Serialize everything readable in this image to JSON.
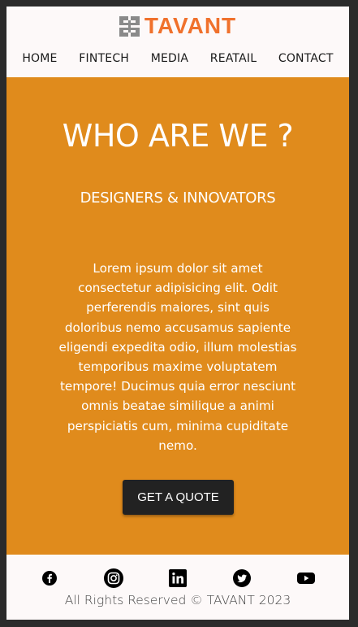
{
  "brand": {
    "name": "TAVANT",
    "color": "#f0712c"
  },
  "nav": {
    "items": [
      "HOME",
      "FINTECH",
      "MEDIA",
      "REATAIL",
      "CONTACT"
    ]
  },
  "hero": {
    "title": "WHO ARE WE ?",
    "subtitle": "DESIGNERS & INNOVATORS",
    "body": "Lorem ipsum dolor sit amet consectetur adipisicing elit. Odit perferendis maiores, sint quis doloribus nemo accusamus sapiente eligendi expedita odio, illum molestias temporibus maxime voluptatem tempore! Ducimus quia error nesciunt omnis beatae similique a animi perspiciatis cum, minima cupiditate nemo.",
    "cta_label": "GET A QUOTE",
    "background": "#e08b1c"
  },
  "footer": {
    "social_icons": [
      "facebook-icon",
      "instagram-icon",
      "linkedin-icon",
      "twitter-icon",
      "youtube-icon"
    ],
    "copyright": "All Rights Reserved © TAVANT 2023"
  }
}
